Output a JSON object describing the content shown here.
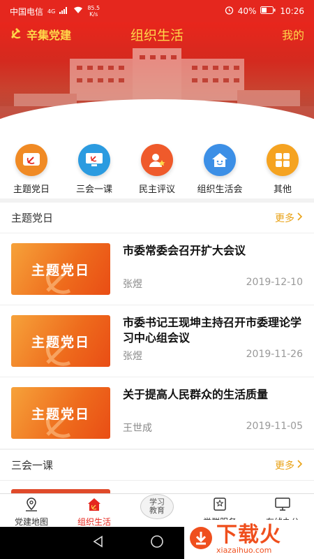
{
  "status_bar": {
    "carrier": "中国电信",
    "network": "4G",
    "speed_value": "85.5",
    "speed_unit": "K/s",
    "battery": "40%",
    "time": "10:26"
  },
  "header": {
    "brand": "辛集党建",
    "title": "组织生活",
    "mine": "我的"
  },
  "categories": [
    {
      "label": "主题党日",
      "color": "#f08a24",
      "icon": "party-emblem-icon"
    },
    {
      "label": "三会一课",
      "color": "#2b9be0",
      "icon": "monitor-icon"
    },
    {
      "label": "民主评议",
      "color": "#ef5a2b",
      "icon": "user-star-icon"
    },
    {
      "label": "组织生活会",
      "color": "#3c8fe6",
      "icon": "home-smile-icon"
    },
    {
      "label": "其他",
      "color": "#f5a321",
      "icon": "grid-icon"
    }
  ],
  "section1": {
    "title": "主题党日",
    "more": "更多",
    "items": [
      {
        "thumb": "主题党日",
        "title": "市委常委会召开扩大会议",
        "author": "张煜",
        "date": "2019-12-10"
      },
      {
        "thumb": "主题党日",
        "title": "市委书记王现坤主持召开市委理论学习中心组会议",
        "author": "张煜",
        "date": "2019-11-26"
      },
      {
        "thumb": "主题党日",
        "title": "关于提高人民群众的生活质量",
        "author": "王世成",
        "date": "2019-11-05"
      }
    ]
  },
  "section2": {
    "title": "三会一课",
    "more": "更多"
  },
  "tabbar": {
    "tabs": [
      {
        "label": "党建地图"
      },
      {
        "label": "组织生活"
      },
      {
        "label": "学习教育",
        "line1": "学习",
        "line2": "教育"
      },
      {
        "label": "党群服务"
      },
      {
        "label": "在线办公"
      }
    ]
  },
  "watermark": {
    "big": "下载火",
    "small": "xiazaihuo.com"
  },
  "colors": {
    "primary_red": "#e5271e",
    "gold": "#ffd84a",
    "more_orange": "#e9a216"
  }
}
